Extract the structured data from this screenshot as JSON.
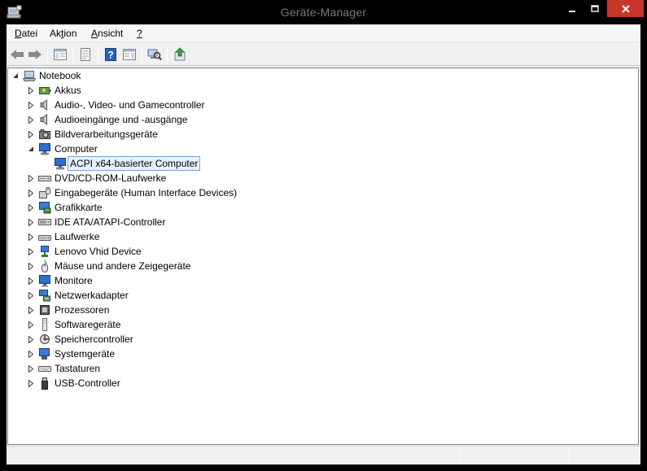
{
  "window": {
    "title": "Geräte-Manager"
  },
  "menu": {
    "datei": {
      "prefix": "",
      "underline": "D",
      "rest": "atei"
    },
    "aktion": {
      "prefix": "Ak",
      "underline": "t",
      "rest": "ion"
    },
    "ansicht": {
      "prefix": "",
      "underline": "A",
      "rest": "nsicht"
    },
    "help": {
      "prefix": "",
      "underline": "?",
      "rest": ""
    }
  },
  "toolbar": {
    "buttons": [
      "back-icon",
      "forward-icon",
      "show-hide-console-tree-icon",
      "properties-icon",
      "help-icon",
      "show-action-pane-icon",
      "scan-hardware-icon",
      "update-driver-icon"
    ]
  },
  "tree": {
    "root": "Notebook",
    "categories": [
      {
        "label": "Akkus",
        "icon": "battery-icon"
      },
      {
        "label": "Audio-, Video- und Gamecontroller",
        "icon": "speaker-icon"
      },
      {
        "label": "Audioeingänge und -ausgänge",
        "icon": "speaker-icon"
      },
      {
        "label": "Bildverarbeitungsgeräte",
        "icon": "camera-icon"
      },
      {
        "label": "Computer",
        "icon": "computer-icon",
        "expanded": true,
        "child": "ACPI x64-basierter Computer"
      },
      {
        "label": "DVD/CD-ROM-Laufwerke",
        "icon": "disc-drive-icon"
      },
      {
        "label": "Eingabegeräte (Human Interface Devices)",
        "icon": "hid-icon"
      },
      {
        "label": "Grafikkarte",
        "icon": "display-adapter-icon"
      },
      {
        "label": "IDE ATA/ATAPI-Controller",
        "icon": "ide-controller-icon"
      },
      {
        "label": "Laufwerke",
        "icon": "disk-drive-icon"
      },
      {
        "label": "Lenovo Vhid Device",
        "icon": "network-device-icon"
      },
      {
        "label": "Mäuse und andere Zeigegeräte",
        "icon": "mouse-icon"
      },
      {
        "label": "Monitore",
        "icon": "monitor-icon"
      },
      {
        "label": "Netzwerkadapter",
        "icon": "network-adapter-icon"
      },
      {
        "label": "Prozessoren",
        "icon": "processor-icon"
      },
      {
        "label": "Softwaregeräte",
        "icon": "software-device-icon"
      },
      {
        "label": "Speichercontroller",
        "icon": "storage-controller-icon"
      },
      {
        "label": "Systemgeräte",
        "icon": "system-device-icon"
      },
      {
        "label": "Tastaturen",
        "icon": "keyboard-icon"
      },
      {
        "label": "USB-Controller",
        "icon": "usb-icon"
      }
    ]
  },
  "colors": {
    "titlebar": "#000000",
    "close_button": "#c7372c",
    "selection_fill": "#e5f3fb",
    "selection_border": "#7da2ce"
  }
}
